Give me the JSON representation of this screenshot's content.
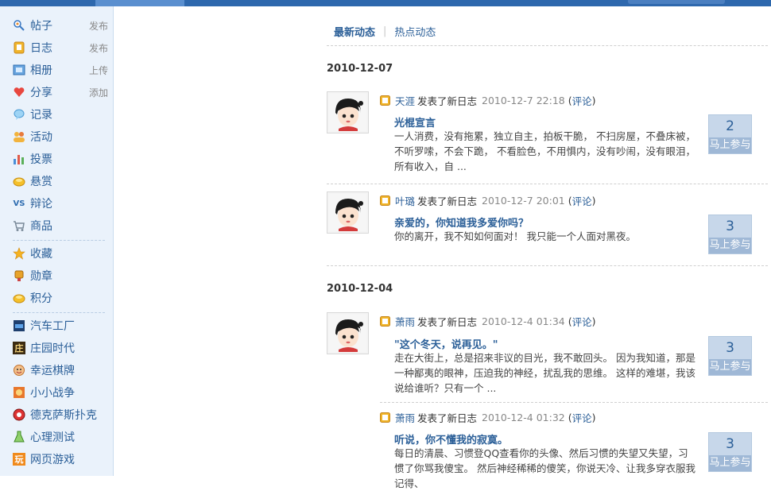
{
  "sidebar": {
    "items": [
      {
        "label": "帖子",
        "action": "发布",
        "icon": "post-icon"
      },
      {
        "label": "日志",
        "action": "发布",
        "icon": "blog-icon"
      },
      {
        "label": "相册",
        "action": "上传",
        "icon": "album-icon"
      },
      {
        "label": "分享",
        "action": "添加",
        "icon": "share-icon"
      },
      {
        "label": "记录",
        "action": "",
        "icon": "record-icon"
      },
      {
        "label": "活动",
        "action": "",
        "icon": "event-icon"
      },
      {
        "label": "投票",
        "action": "",
        "icon": "poll-icon"
      },
      {
        "label": "悬赏",
        "action": "",
        "icon": "reward-icon"
      },
      {
        "label": "辩论",
        "action": "",
        "icon": "debate-icon"
      },
      {
        "label": "商品",
        "action": "",
        "icon": "goods-icon"
      },
      {
        "label": "收藏",
        "action": "",
        "icon": "star-icon"
      },
      {
        "label": "勋章",
        "action": "",
        "icon": "medal-icon"
      },
      {
        "label": "积分",
        "action": "",
        "icon": "points-icon"
      },
      {
        "label": "汽车工厂",
        "action": "",
        "icon": "car-factory-icon"
      },
      {
        "label": "庄园时代",
        "action": "",
        "icon": "manor-icon"
      },
      {
        "label": "幸运棋牌",
        "action": "",
        "icon": "lucky-cards-icon"
      },
      {
        "label": "小小战争",
        "action": "",
        "icon": "war-icon"
      },
      {
        "label": "德克萨斯扑克",
        "action": "",
        "icon": "poker-icon"
      },
      {
        "label": "心理测试",
        "action": "",
        "icon": "psych-test-icon"
      },
      {
        "label": "网页游戏",
        "action": "",
        "icon": "web-game-icon"
      }
    ]
  },
  "tabs": {
    "latest": "最新动态",
    "hot": "热点动态"
  },
  "colors": {
    "link": "#2b5f98",
    "topbar": "#2e68ad",
    "sidebar_bg": "#eaf2fb",
    "count_bg": "#c7d7ea"
  },
  "groups": [
    {
      "date": "2010-12-07",
      "entries": [
        {
          "user": "天涯",
          "verb": "发表了新日志",
          "time": "2010-12-7 22:18",
          "comment": "评论",
          "title": "光棍宣言",
          "body": "一人消费，没有拖累，独立自主，拍板干脆， 不扫房屋，不叠床被，不听罗嗦，不会下跪， 不看脸色，不用惧内，没有吵闹，没有眼泪， 所有收入，自 ...",
          "count": "2",
          "join": "马上参与"
        },
        {
          "user": "叶璐",
          "verb": "发表了新日志",
          "time": "2010-12-7 20:01",
          "comment": "评论",
          "title": "亲爱的，你知道我多爱你吗？",
          "body": "你的离开，我不知如何面对！ 我只能一个人面对黑夜。",
          "count": "3",
          "join": "马上参与"
        }
      ]
    },
    {
      "date": "2010-12-04",
      "entries": [
        {
          "user": "萧雨",
          "verb": "发表了新日志",
          "time": "2010-12-4 01:34",
          "comment": "评论",
          "title": "\"这个冬天，说再见。\"",
          "body": "走在大街上，总是招来非议的目光，我不敢回头。 因为我知道，那是一种鄙夷的眼神，压迫我的神经，扰乱我的思维。 这样的难堪，我该说给谁听？只有一个 ...",
          "count": "3",
          "join": "马上参与"
        },
        {
          "user": "萧雨",
          "verb": "发表了新日志",
          "time": "2010-12-4 01:32",
          "comment": "评论",
          "title": "听说，你不懂我的寂寞。",
          "body": "每日的清晨、习惯登QQ查看你的头像、然后习惯的失望又失望，习惯了你骂我傻宝。 然后神经稀稀的傻笑，你说天冷、让我多穿衣服我记得、",
          "count": "3",
          "join": "马上参与"
        }
      ]
    }
  ]
}
